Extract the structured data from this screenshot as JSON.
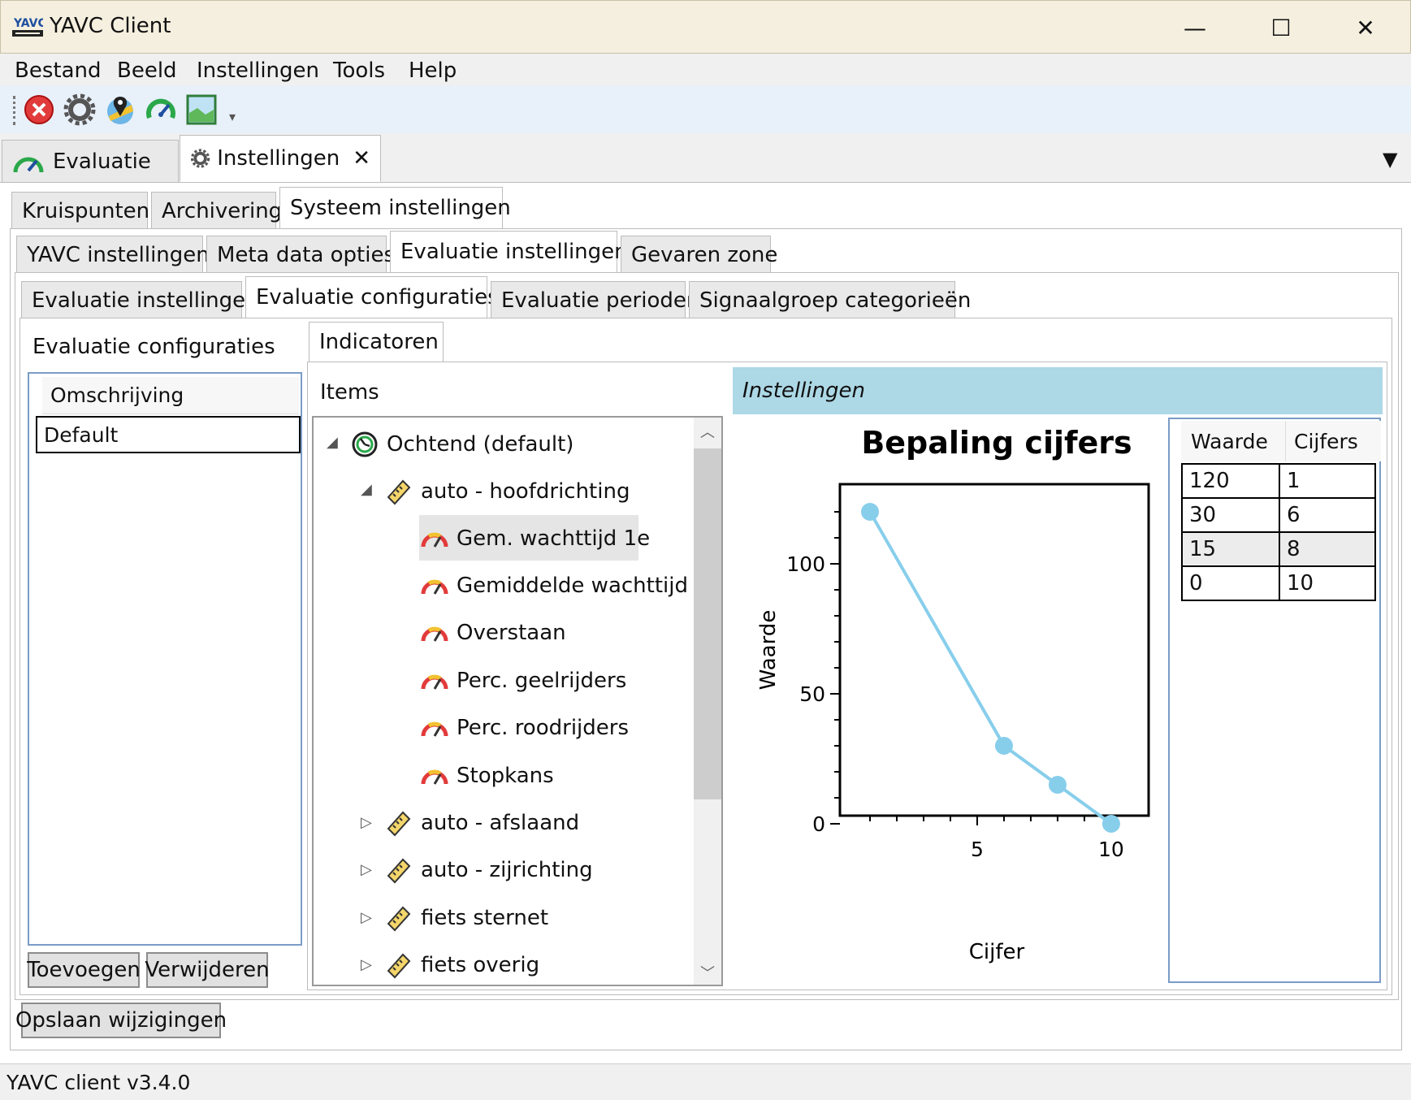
{
  "window": {
    "title": "YAVC Client",
    "minimize": "—",
    "maximize": "☐",
    "close": "✕"
  },
  "menu": [
    "Bestand",
    "Beeld",
    "Instellingen",
    "Tools",
    "Help"
  ],
  "toolbar": {
    "icons": [
      "close-red-icon",
      "gear-icon",
      "map-pin-icon",
      "speedometer-icon",
      "image-icon"
    ]
  },
  "main_tabs": [
    {
      "label": "Evaluatie",
      "icon": "speedometer-icon"
    },
    {
      "label": "Instellingen",
      "icon": "gear-icon",
      "close": "✕"
    }
  ],
  "level1_tabs": [
    "Kruispunten",
    "Archivering",
    "Systeem instellingen"
  ],
  "level2_tabs": [
    "YAVC instellingen",
    "Meta data opties",
    "Evaluatie instellingen",
    "Gevaren zone"
  ],
  "level3_tabs": [
    "Evaluatie instellingen",
    "Evaluatie configuraties",
    "Evaluatie perioden",
    "Signaalgroep categorieën"
  ],
  "configs": {
    "heading": "Evaluatie configuraties",
    "column": "Omschrijving",
    "rows": [
      "Default"
    ],
    "add_button": "Toevoegen",
    "remove_button": "Verwijderen"
  },
  "indicators_tab": "Indicatoren",
  "items": {
    "heading": "Items",
    "root": "Ochtend  (default)",
    "group": "auto - hoofdrichting",
    "children": [
      "Gem. wachttijd 1e",
      "Gemiddelde wachttijd",
      "Overstaan",
      "Perc. geelrijders",
      "Perc. roodrijders",
      "Stopkans"
    ],
    "siblings": [
      "auto - afslaand",
      "auto - zijrichting",
      "fiets sternet",
      "fiets overig"
    ]
  },
  "settings": {
    "header": "Instellingen",
    "table": {
      "columns": [
        "Waarde",
        "Cijfers"
      ],
      "rows": [
        [
          "120",
          "1"
        ],
        [
          "30",
          "6"
        ],
        [
          "15",
          "8"
        ],
        [
          "0",
          "10"
        ]
      ]
    }
  },
  "chart_data": {
    "type": "line",
    "title": "Bepaling cijfers",
    "xlabel": "Cijfer",
    "ylabel": "Waarde",
    "x": [
      1,
      6,
      8,
      10
    ],
    "y": [
      120,
      30,
      15,
      0
    ],
    "xlim": [
      0,
      11
    ],
    "ylim": [
      0,
      120
    ],
    "xticks": [
      "5",
      "10"
    ],
    "yticks": [
      "0",
      "50",
      "100"
    ],
    "color": "#87ceeb",
    "grid": false
  },
  "save_button": "Opslaan wijzigingen",
  "status": "YAVC client v3.4.0"
}
